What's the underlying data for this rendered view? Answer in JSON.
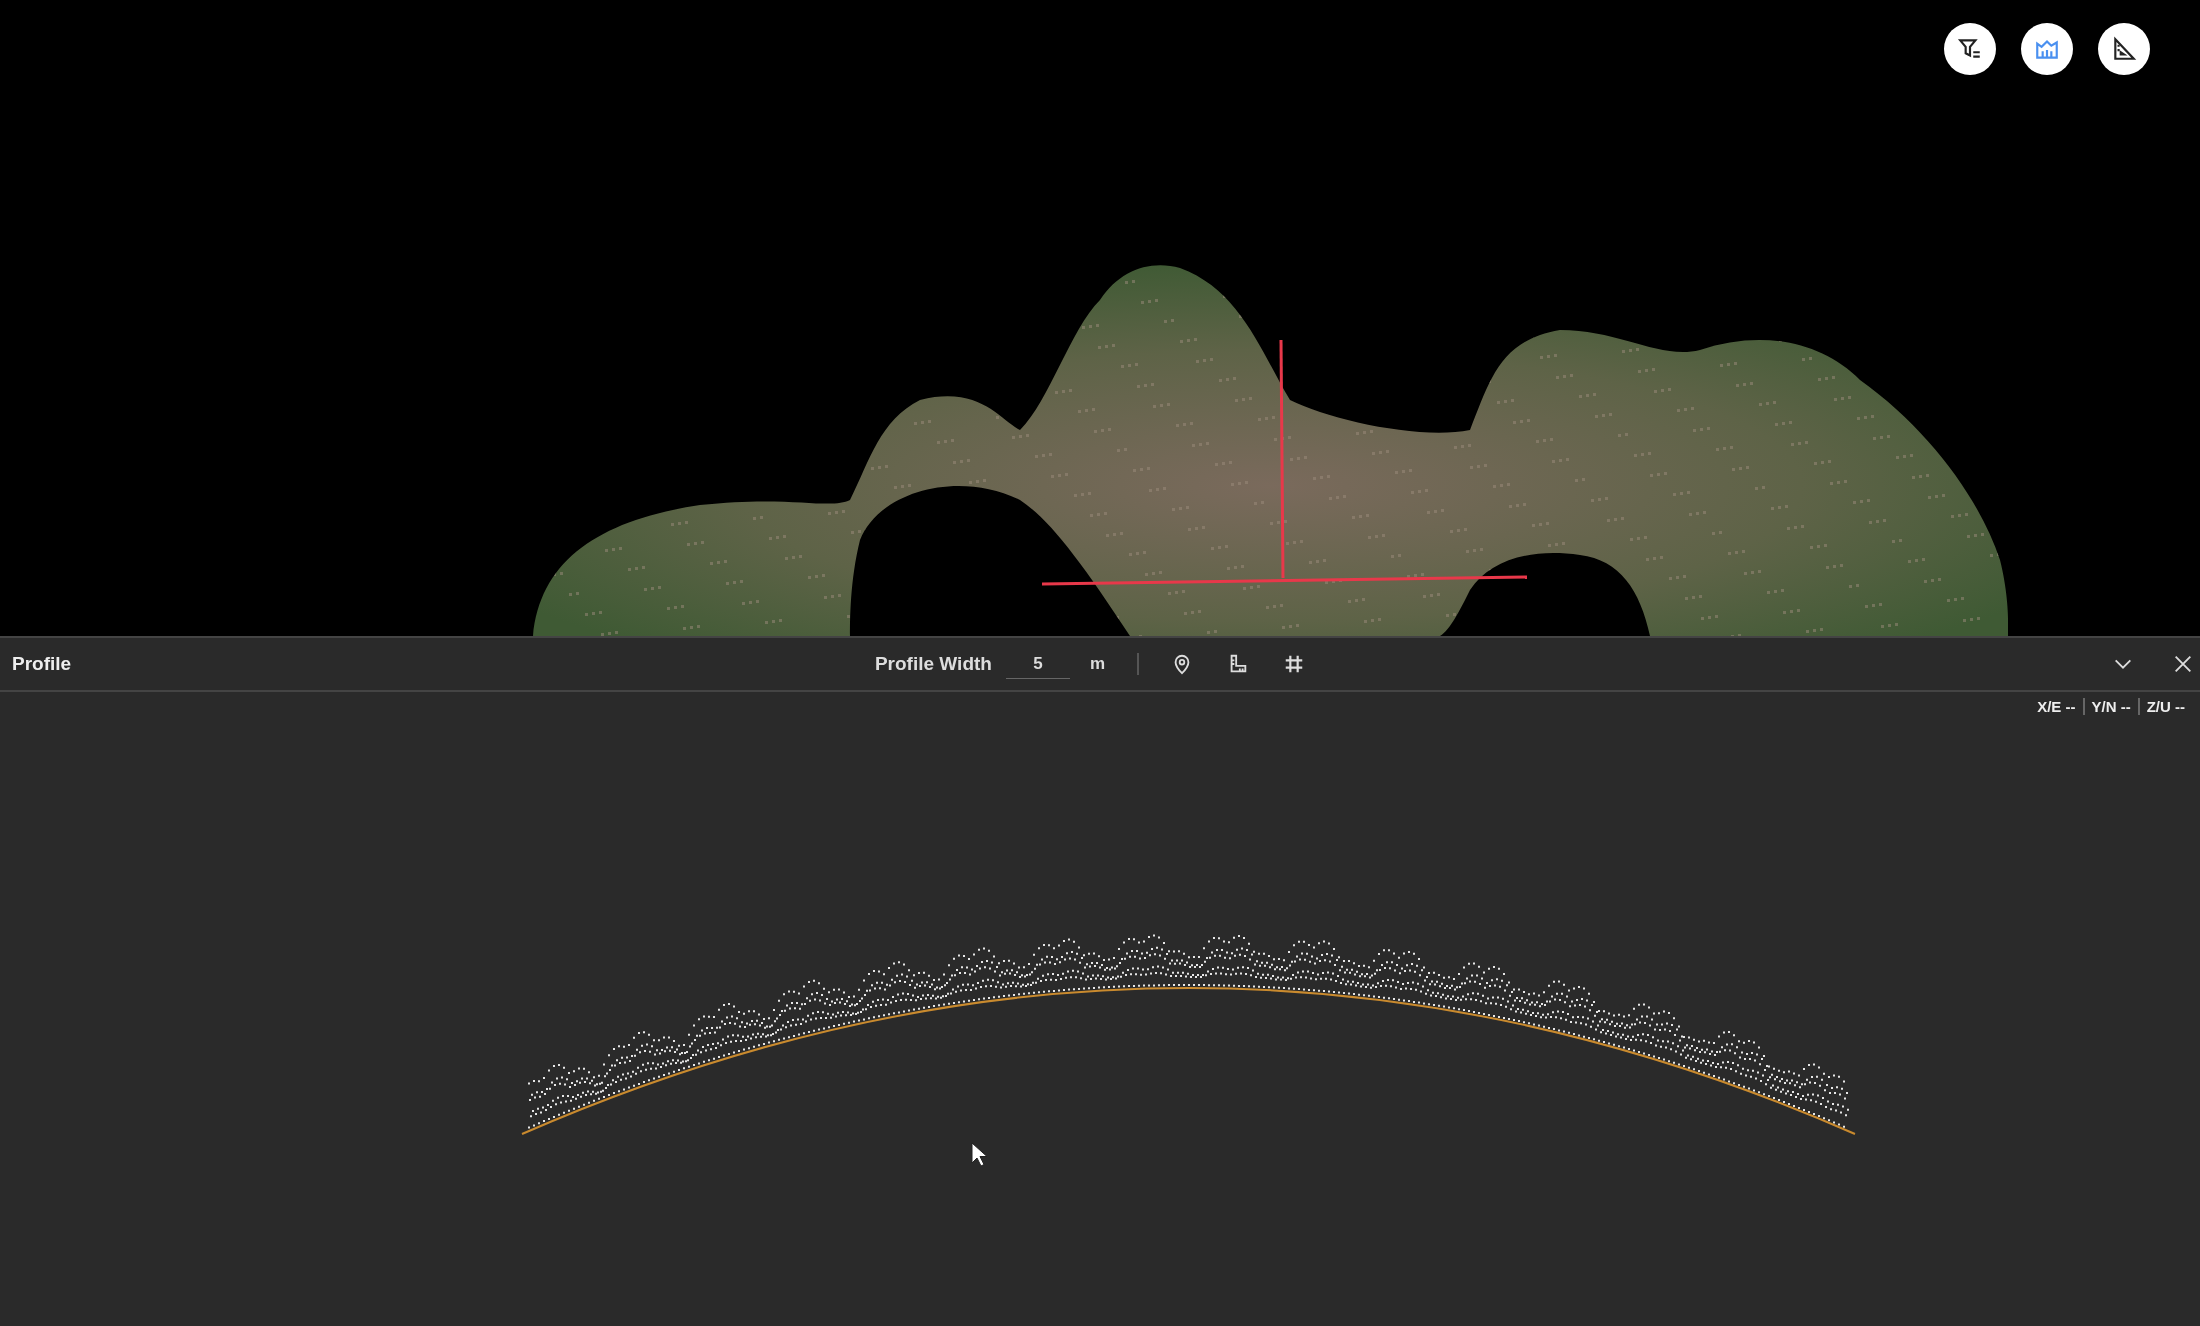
{
  "viewport": {
    "map_buttons": [
      {
        "kind": "filter",
        "selected": false
      },
      {
        "kind": "profile",
        "selected": true
      },
      {
        "kind": "measure",
        "selected": false
      }
    ]
  },
  "profile_panel": {
    "title": "Profile",
    "width_label": "Profile Width",
    "width_field": {
      "value": "5"
    },
    "unit": "m",
    "tools": [
      {
        "kind": "pin"
      },
      {
        "kind": "ruler"
      },
      {
        "kind": "grid"
      }
    ],
    "coordinates": [
      {
        "label": "X/E",
        "value": "--"
      },
      {
        "label": "Y/N",
        "value": "--"
      },
      {
        "label": "Z/U",
        "value": "--"
      }
    ]
  }
}
